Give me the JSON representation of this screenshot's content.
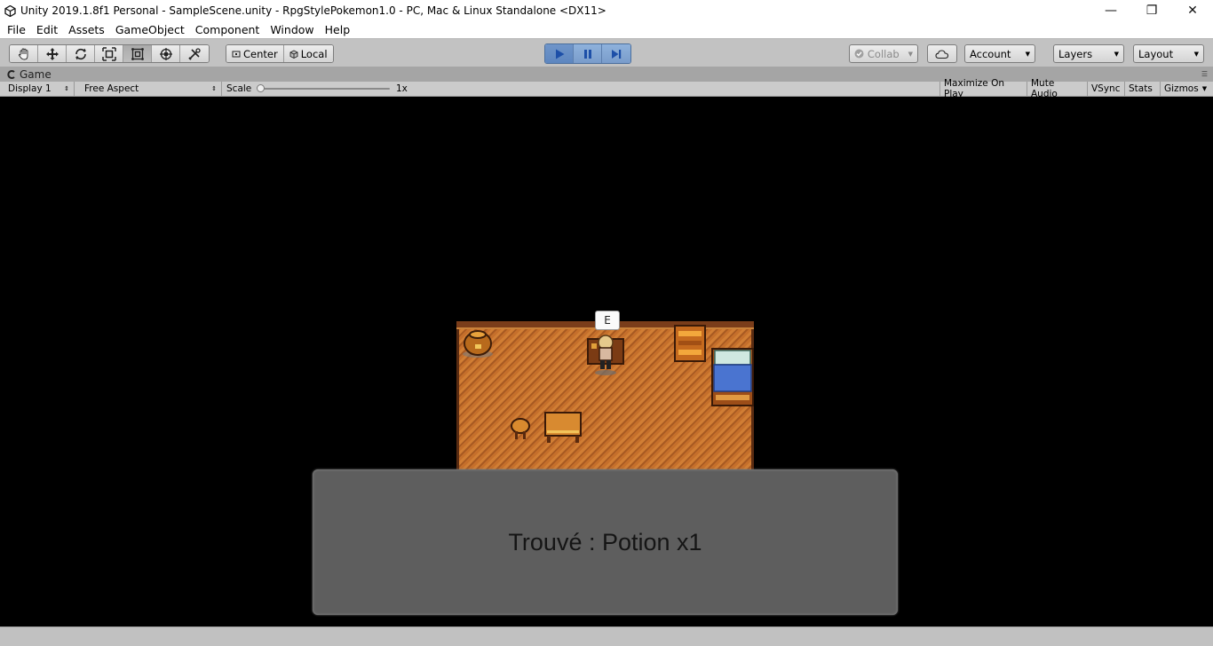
{
  "window": {
    "title": "Unity 2019.1.8f1 Personal - SampleScene.unity - RpgStylePokemon1.0 - PC, Mac & Linux Standalone <DX11>",
    "controls": {
      "minimize": "—",
      "restore": "❐",
      "close": "✕"
    }
  },
  "menu": {
    "items": [
      "File",
      "Edit",
      "Assets",
      "GameObject",
      "Component",
      "Window",
      "Help"
    ]
  },
  "toolbar": {
    "tools": [
      {
        "name": "hand-tool",
        "icon": "hand-icon"
      },
      {
        "name": "move-tool",
        "icon": "move-icon"
      },
      {
        "name": "rotate-tool",
        "icon": "rotate-icon"
      },
      {
        "name": "scale-tool",
        "icon": "scale-icon"
      },
      {
        "name": "rect-tool",
        "icon": "rect-icon"
      },
      {
        "name": "transform-tool",
        "icon": "transform-icon"
      },
      {
        "name": "custom-tool",
        "icon": "custom-tool-icon"
      }
    ],
    "pivot_center": "Center",
    "pivot_local": "Local",
    "collab": "Collab",
    "account": "Account",
    "layers": "Layers",
    "layout": "Layout"
  },
  "game_tab": {
    "label": "Game"
  },
  "game_controls": {
    "display": "Display 1",
    "aspect": "Free Aspect",
    "scale_label": "Scale",
    "scale_value": "1x",
    "scale_level": 0.0,
    "maximize_on_play": "Maximize On Play",
    "mute_audio": "Mute Audio",
    "vsync": "VSync",
    "stats": "Stats",
    "gizmos": "Gizmos"
  },
  "game": {
    "interact_prompt": "E",
    "dialog_text": "Trouvé : Potion x1"
  },
  "colors": {
    "play_accent": "#5d86c0",
    "editor_gray": "#c2c2c2",
    "game_background": "#000000",
    "dialog_background": "#5e5e5e",
    "floor": "#c3702a"
  }
}
